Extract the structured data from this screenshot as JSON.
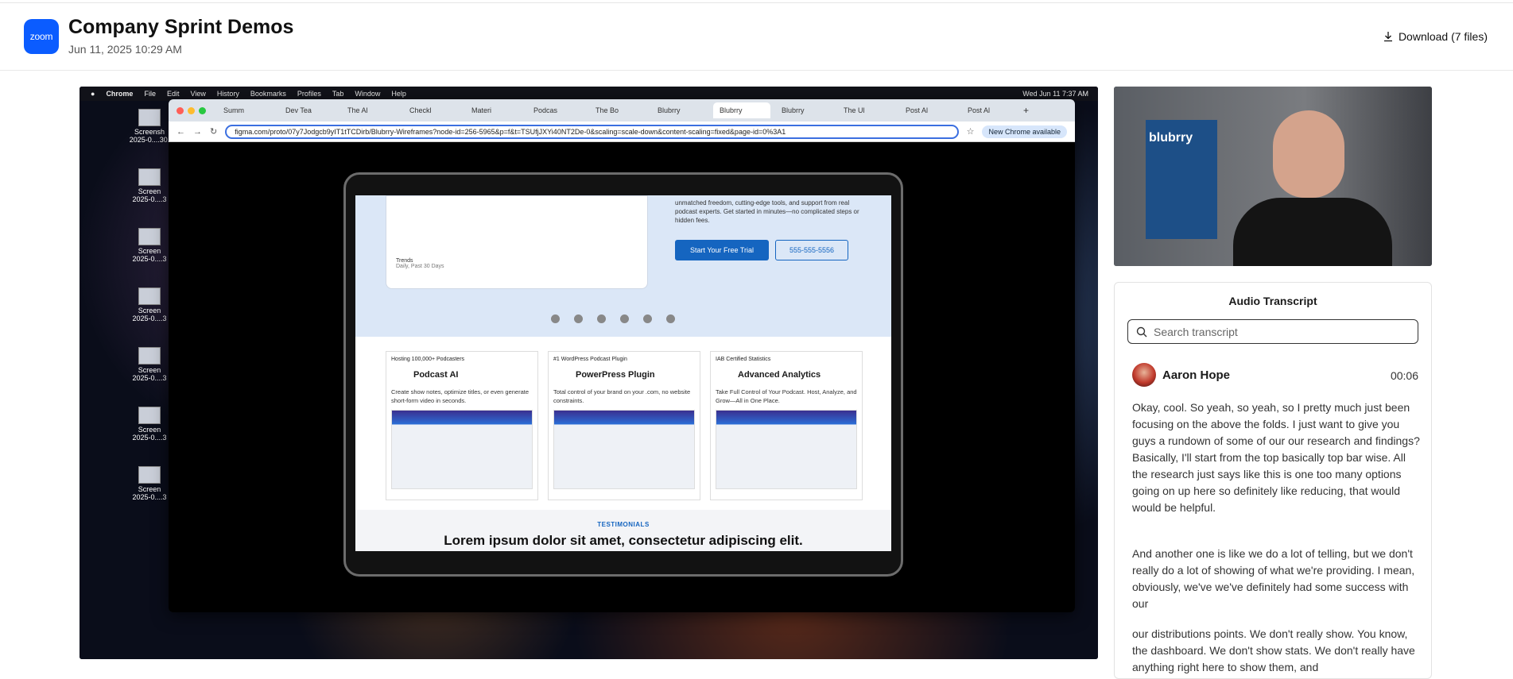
{
  "app": {
    "logo_text": "zoom",
    "title": "Company Sprint Demos",
    "date": "Jun 11, 2025 10:29 AM",
    "download_label": "Download (7 files)"
  },
  "mac": {
    "menu": [
      "Chrome",
      "File",
      "Edit",
      "View",
      "History",
      "Bookmarks",
      "Profiles",
      "Tab",
      "Window",
      "Help"
    ],
    "clock": "Wed Jun 11  7:37 AM",
    "desktop_files": [
      "Screensh\n2025-0....30.",
      "Screen\n2025-0....3",
      "Screen\n2025-0....3",
      "Screen\n2025-0....3",
      "Screen\n2025-0....3",
      "Screen\n2025-0....3",
      "Screen\n2025-0....3"
    ]
  },
  "browser": {
    "tabs": [
      "Summ",
      "Dev Tea",
      "The Al",
      "Checkl",
      "Materi",
      "Podcas",
      "The Bo",
      "Blubrry",
      "Blubrry",
      "Blubrry",
      "The Ul",
      "Post Al",
      "Post Al"
    ],
    "active_tab_index": 8,
    "url": "figma.com/proto/07y7Jodgcb9yIT1tTCDirb/Blubrry-Wireframes?node-id=256-5965&p=f&t=TSUfjJXYi40NT2De-0&scaling=scale-down&content-scaling=fixed&page-id=0%3A1",
    "chrome_notice": "New Chrome available"
  },
  "site": {
    "hero_text": "unmatched freedom, cutting-edge tools, and support from real podcast experts. Get started in minutes—no complicated steps or hidden fees.",
    "trends_label": "Trends",
    "trends_sub": "Daily, Past 30 Days",
    "cta_primary": "Start Your Free Trial",
    "cta_secondary": "555-555-5556",
    "cards": [
      {
        "sub": "Hosting 100,000+ Podcasters",
        "name": "Podcast AI",
        "desc": "Create show notes, optimize titles, or even generate short-form video in seconds."
      },
      {
        "sub": "#1 WordPress Podcast Plugin",
        "name": "PowerPress Plugin",
        "desc": "Total control of your brand on your .com, no website constraints."
      },
      {
        "sub": "IAB Certified Statistics",
        "name": "Advanced Analytics",
        "desc": "Take Full Control of Your Podcast. Host, Analyze, and Grow—All in One Place."
      }
    ],
    "testimonials_label": "TESTIMONIALS",
    "testimonials_heading": "Lorem ipsum dolor sit amet, consectetur adipiscing elit."
  },
  "participant": {
    "poster_text": "blubrry"
  },
  "transcript": {
    "title": "Audio Transcript",
    "search_placeholder": "Search transcript",
    "speaker": "Aaron Hope",
    "timestamp": "00:06",
    "paragraphs": [
      "Okay, cool. So yeah, so yeah, so I pretty much just been focusing on the above the folds. I just want to give you guys a rundown of some of our our research and findings? Basically, I'll start from the top basically top bar wise. All the research just says like this is one too many options going on up here so definitely like reducing, that would would be helpful.",
      "And another one is like we do a lot of telling, but we don't really do a lot of showing of what we're providing. I mean, obviously, we've we've definitely had some success with our",
      "our distributions points. We don't really show. You know, the dashboard. We don't show stats. We don't really have anything right here to show them, and"
    ]
  }
}
